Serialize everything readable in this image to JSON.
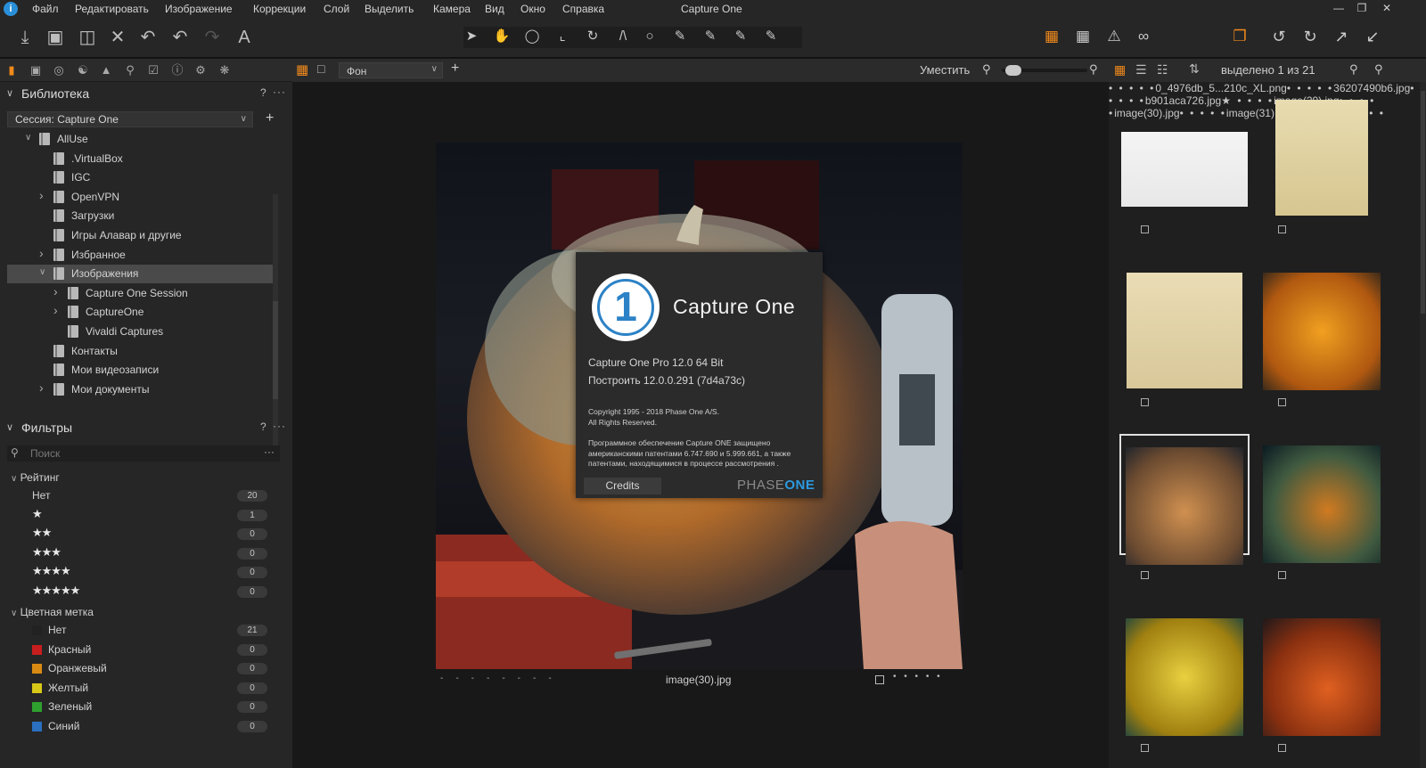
{
  "app": {
    "window_title": "Capture One",
    "logo_glyph": "i",
    "menu": [
      "Файл",
      "Редактировать",
      "Изображение",
      "Коррекции",
      "Слой",
      "Выделить",
      "Камера",
      "Вид",
      "Окно",
      "Справка"
    ],
    "window_controls": [
      "minimize-icon",
      "restore-icon",
      "close-icon"
    ]
  },
  "toolbar": {
    "left_icons": [
      "import-icon",
      "camera-icon",
      "folder-icon",
      "delete-icon",
      "undo-icon",
      "undo-step-icon",
      "redo-icon",
      "text-icon"
    ],
    "cursor_tools": [
      "select-icon",
      "pan-icon",
      "loupe-icon",
      "crop-icon",
      "rotate-icon",
      "keystone-icon",
      "spot-icon",
      "brush-icon",
      "eraser-icon",
      "gradient-icon",
      "picker-icon"
    ],
    "right_icons": [
      "edit-icon",
      "grid-icon",
      "warning-icon",
      "glasses-icon",
      "layers-icon",
      "rotate-left-icon",
      "rotate-right-icon",
      "expand-icon",
      "collapse-icon"
    ],
    "accent": "#f08a1c"
  },
  "library": {
    "title": "Библиотека",
    "help": "?",
    "more": "···",
    "session": "Сессия: Capture One",
    "add": "+",
    "tree": [
      {
        "label": "AllUse",
        "level": 0,
        "expander": "open"
      },
      {
        "label": ".VirtualBox",
        "level": 1,
        "expander": ""
      },
      {
        "label": "IGC",
        "level": 1,
        "expander": ""
      },
      {
        "label": "OpenVPN",
        "level": 1,
        "expander": "closed"
      },
      {
        "label": "Загрузки",
        "level": 1,
        "expander": ""
      },
      {
        "label": "Игры Алавар и другие",
        "level": 1,
        "expander": ""
      },
      {
        "label": "Избранное",
        "level": 1,
        "expander": "closed"
      },
      {
        "label": "Изображения",
        "level": 1,
        "expander": "open",
        "selected": true
      },
      {
        "label": "Capture One Session",
        "level": 2,
        "expander": "closed"
      },
      {
        "label": "CaptureOne",
        "level": 2,
        "expander": "closed"
      },
      {
        "label": "Vivaldi Captures",
        "level": 2,
        "expander": ""
      },
      {
        "label": "Контакты",
        "level": 1,
        "expander": ""
      },
      {
        "label": "Мои видеозаписи",
        "level": 1,
        "expander": ""
      },
      {
        "label": "Мои документы",
        "level": 1,
        "expander": "closed"
      }
    ]
  },
  "filters": {
    "title": "Фильтры",
    "help": "?",
    "more": "···",
    "search_placeholder": "Поиск",
    "search_more": "···",
    "rating_title": "Рейтинг",
    "rating": [
      {
        "label": "Нет",
        "stars": "",
        "count": "20"
      },
      {
        "label": "",
        "stars": "★",
        "count": "1"
      },
      {
        "label": "",
        "stars": "★★",
        "count": "0"
      },
      {
        "label": "",
        "stars": "★★★",
        "count": "0"
      },
      {
        "label": "",
        "stars": "★★★★",
        "count": "0"
      },
      {
        "label": "",
        "stars": "★★★★★",
        "count": "0"
      }
    ],
    "color_title": "Цветная метка",
    "colors": [
      {
        "label": "Нет",
        "color": "#222222",
        "count": "21"
      },
      {
        "label": "Красный",
        "color": "#c81e1e",
        "count": "0"
      },
      {
        "label": "Оранжевый",
        "color": "#d98a12",
        "count": "0"
      },
      {
        "label": "Желтый",
        "color": "#d8c818",
        "count": "0"
      },
      {
        "label": "Зеленый",
        "color": "#2ea02e",
        "count": "0"
      },
      {
        "label": "Синий",
        "color": "#2a6fc0",
        "count": "0"
      }
    ]
  },
  "viewer": {
    "variant": "Фон",
    "fit": "Уместить",
    "zoom_level": 0.05,
    "filename": "image(30).jpg",
    "dash_labels": [
      "--",
      "--",
      "--",
      "--"
    ],
    "rating_dots": "• • • • •"
  },
  "about": {
    "logo_digit": "1",
    "title": "Capture One",
    "version": "Capture One Pro 12.0  64 Bit",
    "build": "Построить 12.0.0.291 (7d4a73c)",
    "copyright": "Copyright 1995 - 2018 Phase One A/S.",
    "rights": "All Rights Reserved.",
    "patent": "Программное обеспечение Capture ONE защищено американскими патентами  6.747.690 и 5.999.661, а также патентами, находящимися в процессе рассмотрения .",
    "credits": "Credits",
    "brand_phase": "PHASE",
    "brand_one": "ONE",
    "brand_color": "#2c9ae0"
  },
  "browser": {
    "selection": "выделено 1 из 21",
    "thumbs": [
      {
        "name": "0_4976db_5...210c_XL.png",
        "rating": "• • • • •"
      },
      {
        "name": "36207490b6.jpg",
        "rating": "• • • • •"
      },
      {
        "name": "b901aca726.jpg",
        "rating": "• • • • •"
      },
      {
        "name": "image(29).jpg",
        "rating": "★ • • • •"
      },
      {
        "name": "image(30).jpg",
        "rating": "• • • • •",
        "selected": true
      },
      {
        "name": "image(31).jpg",
        "rating": "• • • • •"
      },
      {
        "name": "",
        "rating": "• • • • •"
      },
      {
        "name": "",
        "rating": "• • • • •"
      }
    ]
  }
}
